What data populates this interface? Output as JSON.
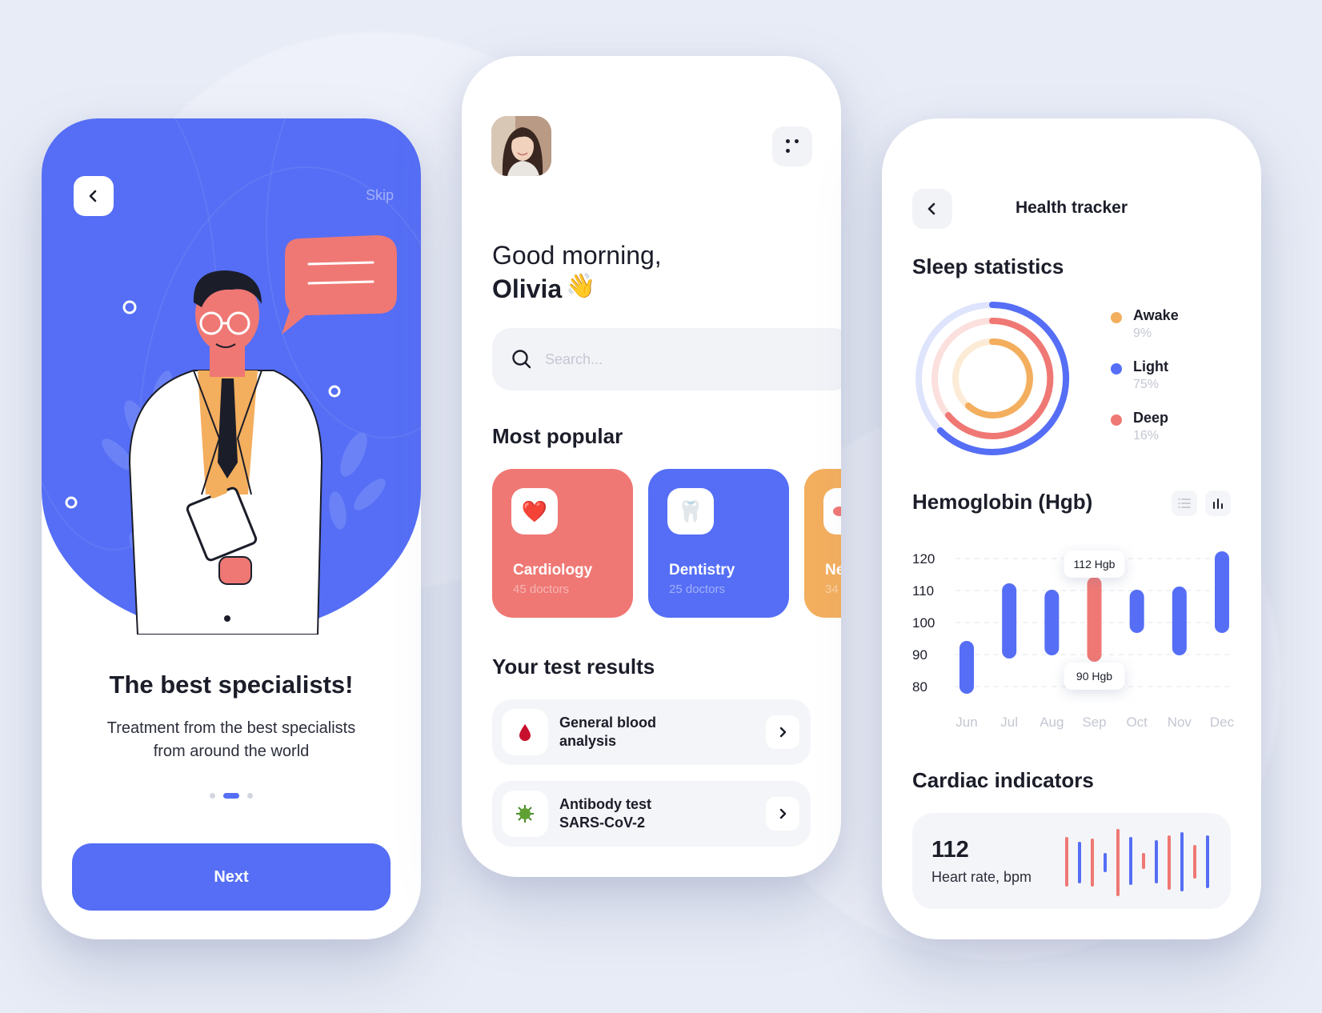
{
  "colors": {
    "primary": "#556ef5",
    "coral": "#ef7874",
    "orange": "#f3ae5e",
    "dark": "#1b1d29",
    "muted": "#c4c7d2"
  },
  "onboarding": {
    "back_icon": "chevron-left-icon",
    "skip_label": "Skip",
    "title": "The best specialists!",
    "subtitle_line1": "Treatment from the best specialists",
    "subtitle_line2": "from around the world",
    "pages": 3,
    "active_page": 2,
    "next_label": "Next"
  },
  "home": {
    "menu_icon": "dots-menu-icon",
    "greeting": "Good morning,",
    "user_name": "Olivia",
    "wave_emoji": "👋",
    "search": {
      "placeholder": "Search..."
    },
    "popular_heading": "Most popular",
    "categories": [
      {
        "name": "Cardiology",
        "count": "45 doctors",
        "icon": "❤️",
        "color": "#ef7874"
      },
      {
        "name": "Dentistry",
        "count": "25 doctors",
        "icon": "🦷",
        "color": "#556ef5"
      },
      {
        "name": "Ne",
        "count": "34",
        "icon": "brain-icon",
        "color": "#f3ae5e"
      }
    ],
    "tests_heading": "Your test results",
    "tests": [
      {
        "line1": "General blood",
        "line2": "analysis",
        "icon": "blood-drop-icon"
      },
      {
        "line1": "Antibody test",
        "line2": "SARS-CoV-2",
        "icon": "virus-icon"
      }
    ]
  },
  "tracker": {
    "title": "Health tracker",
    "sleep_heading": "Sleep statistics",
    "sleep": [
      {
        "label": "Awake",
        "value": "9%",
        "color": "#f3ae5e"
      },
      {
        "label": "Light",
        "value": "75%",
        "color": "#556ef5"
      },
      {
        "label": "Deep",
        "value": "16%",
        "color": "#ef7874"
      }
    ],
    "hgb_heading": "Hemoglobin (Hgb)",
    "cardiac_heading": "Cardiac indicators",
    "heart_rate_value": "112",
    "heart_rate_label": "Heart rate, bpm"
  },
  "chart_data": {
    "type": "bar",
    "title": "Hemoglobin (Hgb)",
    "categories": [
      "Jun",
      "Jul",
      "Aug",
      "Sep",
      "Oct",
      "Nov",
      "Dec"
    ],
    "series": [
      {
        "ranges": [
          [
            80,
            92
          ],
          [
            91,
            110
          ],
          [
            92,
            108
          ],
          [
            90,
            112
          ],
          [
            99,
            108
          ],
          [
            92,
            109
          ],
          [
            99,
            120
          ]
        ]
      }
    ],
    "highlight_category": "Sep",
    "annotations": [
      "112 Hgb",
      "90 Hgb"
    ],
    "yticks": [
      "120",
      "110",
      "100",
      "90",
      "80"
    ],
    "ylim": [
      80,
      120
    ],
    "grid": true
  }
}
